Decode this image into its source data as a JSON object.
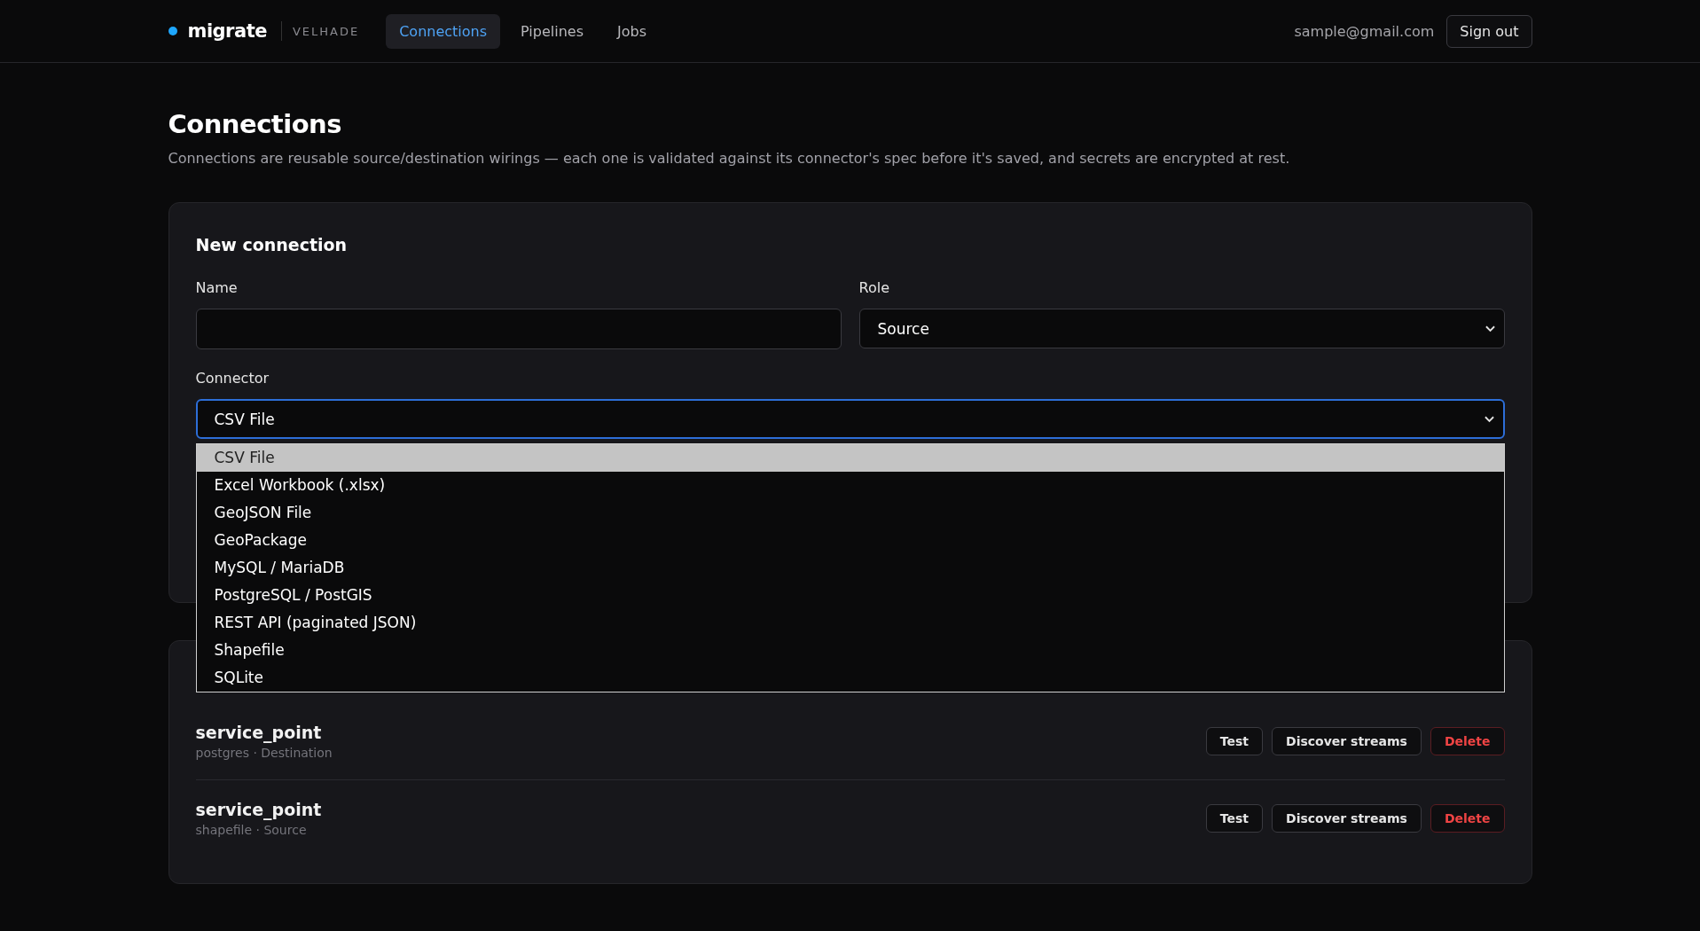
{
  "header": {
    "brand": "migrate",
    "workspace": "VELHADE",
    "nav": [
      {
        "label": "Connections",
        "selected": true
      },
      {
        "label": "Pipelines",
        "selected": false
      },
      {
        "label": "Jobs",
        "selected": false
      }
    ],
    "user_email": "sample@gmail.com",
    "sign_out": "Sign out"
  },
  "page": {
    "title": "Connections",
    "description": "Connections are reusable source/destination wirings — each one is validated against its connector's spec before it's saved, and secrets are encrypted at rest."
  },
  "new_connection": {
    "title": "New connection",
    "name_field": {
      "label": "Name"
    },
    "role_field": {
      "label": "Role",
      "value": "Source"
    },
    "connector_field": {
      "label": "Connector",
      "value": "CSV File",
      "expanded": true,
      "options": [
        {
          "label": "CSV File",
          "selected": true
        },
        {
          "label": "Excel Workbook (.xlsx)",
          "selected": false
        },
        {
          "label": "GeoJSON File",
          "selected": false
        },
        {
          "label": "GeoPackage",
          "selected": false
        },
        {
          "label": "MySQL / MariaDB",
          "selected": false
        },
        {
          "label": "PostgreSQL / PostGIS",
          "selected": false
        },
        {
          "label": "REST API (paginated JSON)",
          "selected": false
        },
        {
          "label": "Shapefile",
          "selected": false
        },
        {
          "label": "SQLite",
          "selected": false
        }
      ]
    }
  },
  "connections": [
    {
      "name": "service_point",
      "meta": "postgres · Destination",
      "actions": [
        {
          "label": "Test",
          "kind": "normal"
        },
        {
          "label": "Discover streams",
          "kind": "normal"
        },
        {
          "label": "Delete",
          "kind": "danger"
        }
      ]
    },
    {
      "name": "service_point",
      "meta": "shapefile · Source",
      "actions": [
        {
          "label": "Test",
          "kind": "normal"
        },
        {
          "label": "Discover streams",
          "kind": "normal"
        },
        {
          "label": "Delete",
          "kind": "danger"
        }
      ]
    }
  ]
}
